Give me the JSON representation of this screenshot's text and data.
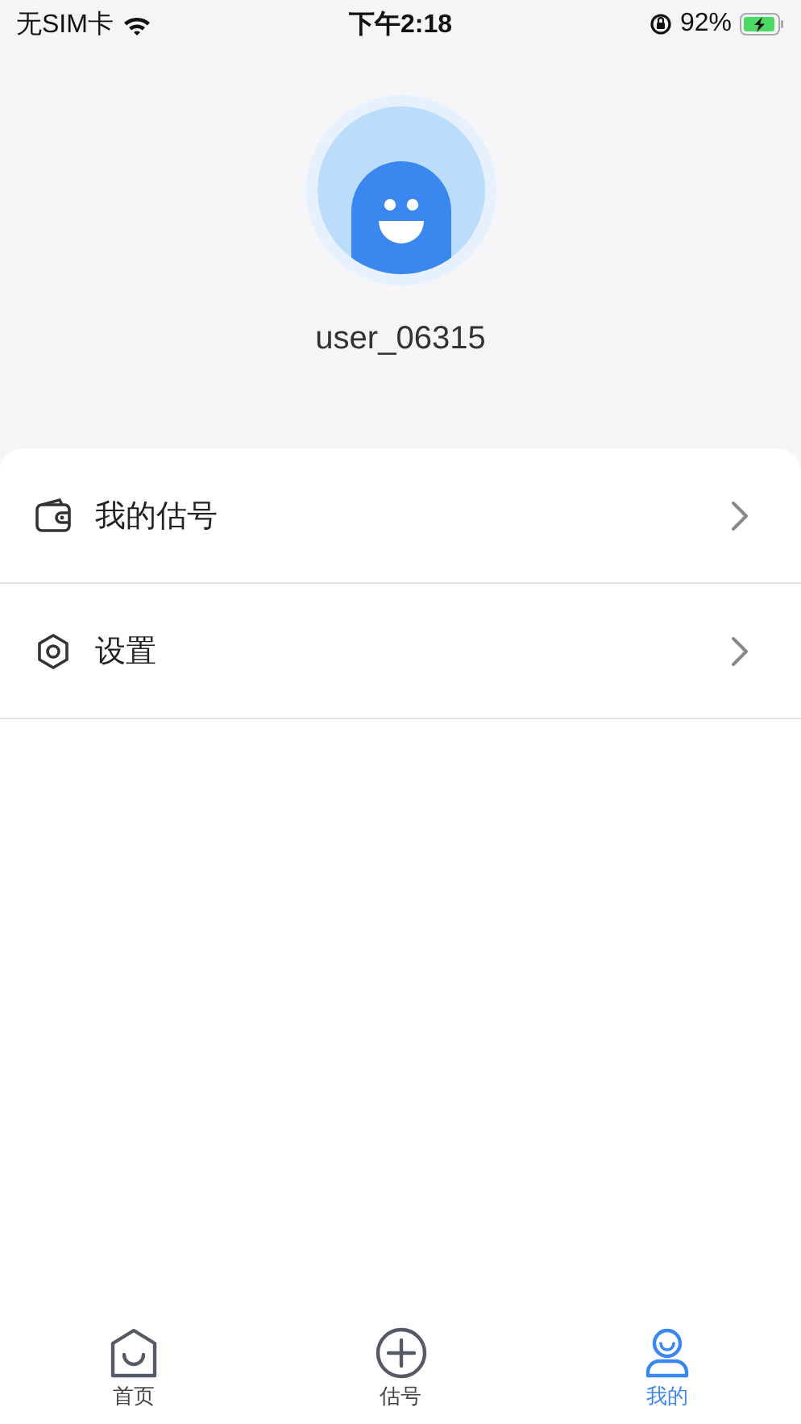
{
  "status_bar": {
    "carrier": "无SIM卡",
    "time": "下午2:18",
    "battery": "92%"
  },
  "profile": {
    "username": "user_06315"
  },
  "menu": [
    {
      "kind": "wallet",
      "label": "我的估号"
    },
    {
      "kind": "settings",
      "label": "设置"
    }
  ],
  "tab_bar": [
    {
      "kind": "home",
      "label": "首页",
      "selected": false
    },
    {
      "kind": "add",
      "label": "估号",
      "selected": false
    },
    {
      "kind": "user",
      "label": "我的",
      "selected": true
    }
  ]
}
